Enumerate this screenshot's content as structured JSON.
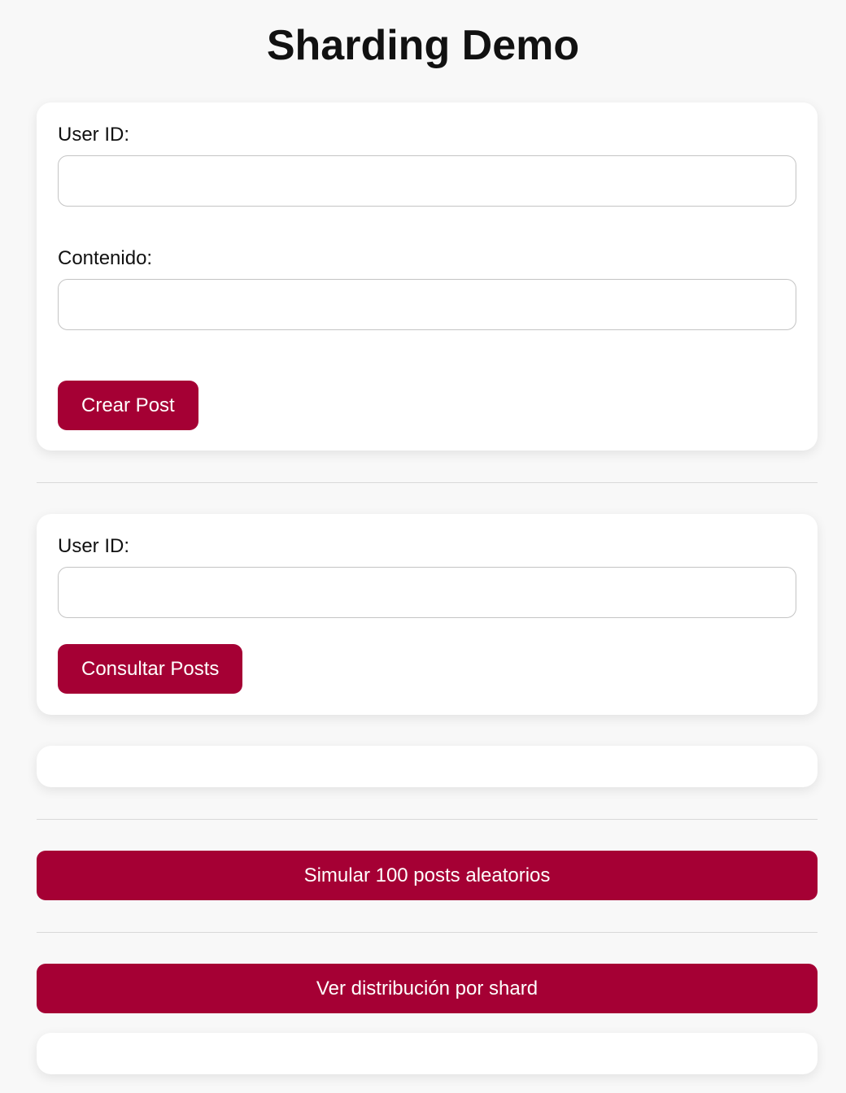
{
  "page": {
    "title": "Sharding Demo"
  },
  "create_form": {
    "user_id_label": "User ID:",
    "user_id_value": "",
    "content_label": "Contenido:",
    "content_value": "",
    "submit_label": "Crear Post"
  },
  "query_form": {
    "user_id_label": "User ID:",
    "user_id_value": "",
    "submit_label": "Consultar Posts"
  },
  "actions": {
    "simulate_label": "Simular 100 posts aleatorios",
    "distribution_label": "Ver distribución por shard"
  },
  "colors": {
    "accent": "#a50034",
    "background": "#f8f8f8",
    "card": "#ffffff"
  }
}
